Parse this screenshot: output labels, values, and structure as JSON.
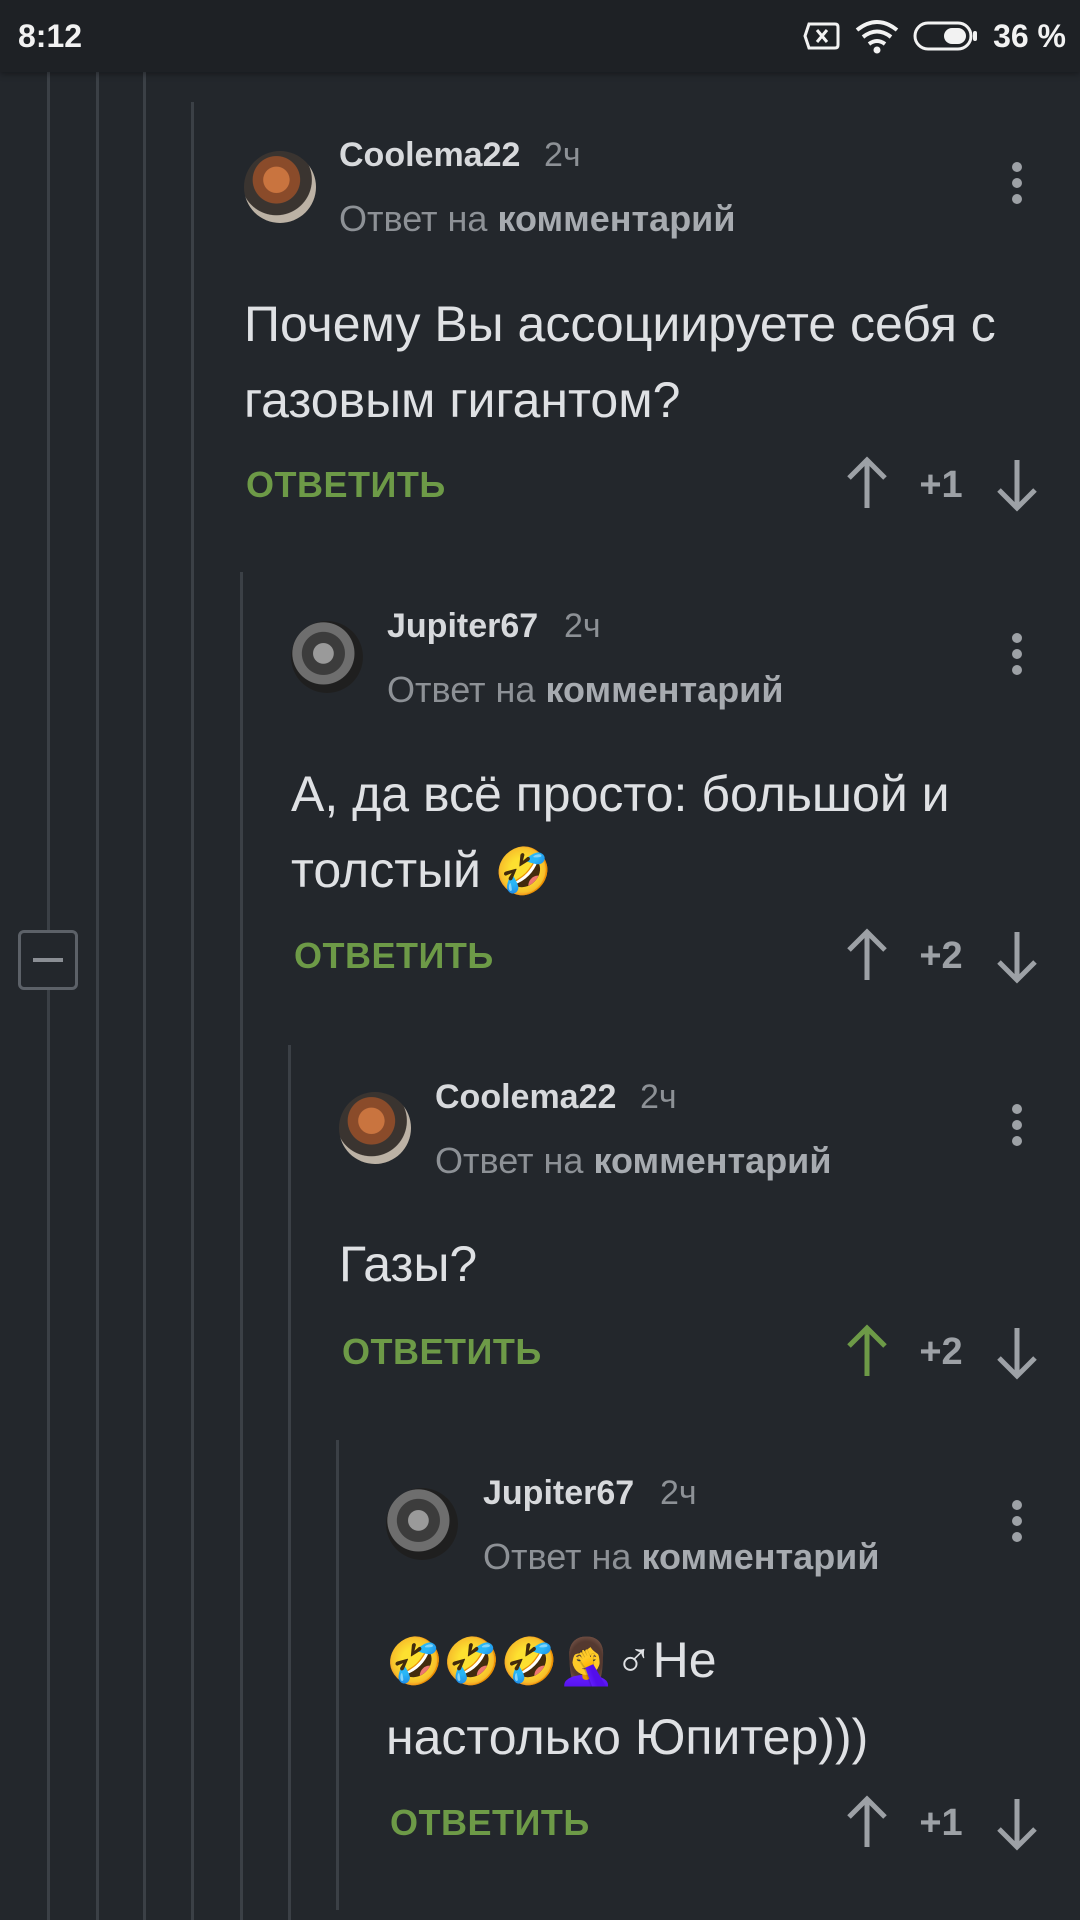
{
  "status_bar": {
    "time": "8:12",
    "battery_percent": "36 %",
    "icons": [
      "sim-off-icon",
      "wifi-icon",
      "battery-icon"
    ]
  },
  "colors": {
    "background": "#23272c",
    "accent_green": "#6d9a47",
    "text": "#dfe1e4",
    "muted": "#8d9196"
  },
  "comments": [
    {
      "username": "Coolema22",
      "time": "2ч",
      "reply_prefix": "Ответ на",
      "reply_target": "комментарий",
      "text": "Почему Вы ассоциируете себя с газовым гигантом?",
      "reply_label": "ОТВЕТИТЬ",
      "score": "+1",
      "upvoted": false
    },
    {
      "username": "Jupiter67",
      "time": "2ч",
      "reply_prefix": "Ответ на",
      "reply_target": "комментарий",
      "text": "А, да всё просто: большой и толстый",
      "emoji": "🤣",
      "reply_label": "ОТВЕТИТЬ",
      "score": "+2",
      "upvoted": false
    },
    {
      "username": "Coolema22",
      "time": "2ч",
      "reply_prefix": "Ответ на",
      "reply_target": "комментарий",
      "text": "Газы?",
      "reply_label": "ОТВЕТИТЬ",
      "score": "+2",
      "upvoted": true
    },
    {
      "username": "Jupiter67",
      "time": "2ч",
      "reply_prefix": "Ответ на",
      "reply_target": "комментарий",
      "emoji": "🤣🤣🤣🤦‍♀️",
      "text_line1": "♂Не",
      "text_line2": "настолько Юпитер)))",
      "reply_label": "ОТВЕТИТЬ",
      "score": "+1",
      "upvoted": false
    }
  ]
}
